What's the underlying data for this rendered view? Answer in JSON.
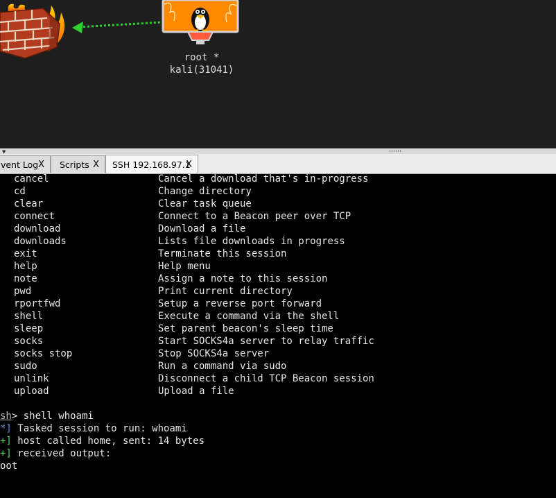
{
  "graph": {
    "session_user": "root *",
    "session_host": "kali(31041)"
  },
  "tabs": [
    {
      "label": "vent Log",
      "close": "X"
    },
    {
      "label": "Scripts",
      "close": "X"
    },
    {
      "label": "SSH 192.168.97.1",
      "close": "X"
    }
  ],
  "console": {
    "commands": [
      {
        "cmd": "cancel",
        "desc": "Cancel a download that's in-progress"
      },
      {
        "cmd": "cd",
        "desc": "Change directory"
      },
      {
        "cmd": "clear",
        "desc": "Clear task queue"
      },
      {
        "cmd": "connect",
        "desc": "Connect to a Beacon peer over TCP"
      },
      {
        "cmd": "download",
        "desc": "Download a file"
      },
      {
        "cmd": "downloads",
        "desc": "Lists file downloads in progress"
      },
      {
        "cmd": "exit",
        "desc": "Terminate this session"
      },
      {
        "cmd": "help",
        "desc": "Help menu"
      },
      {
        "cmd": "note",
        "desc": "Assign a note to this session"
      },
      {
        "cmd": "pwd",
        "desc": "Print current directory"
      },
      {
        "cmd": "rportfwd",
        "desc": "Setup a reverse port forward"
      },
      {
        "cmd": "shell",
        "desc": "Execute a command via the shell"
      },
      {
        "cmd": "sleep",
        "desc": "Set parent beacon's sleep time"
      },
      {
        "cmd": "socks",
        "desc": "Start SOCKS4a server to relay traffic"
      },
      {
        "cmd": "socks stop",
        "desc": "Stop SOCKS4a server"
      },
      {
        "cmd": "sudo",
        "desc": "Run a command via sudo"
      },
      {
        "cmd": "unlink",
        "desc": "Disconnect a child TCP Beacon session"
      },
      {
        "cmd": "upload",
        "desc": "Upload a file"
      }
    ],
    "prompt": "sh",
    "prompt_cmd": "> shell whoami",
    "output": [
      {
        "tag": "*]",
        "text": " Tasked session to run: whoami"
      },
      {
        "tag": "+]",
        "text": " host called home, sent: 14 bytes"
      },
      {
        "tag": "+]",
        "text": " received output:"
      }
    ],
    "result": "oot"
  }
}
